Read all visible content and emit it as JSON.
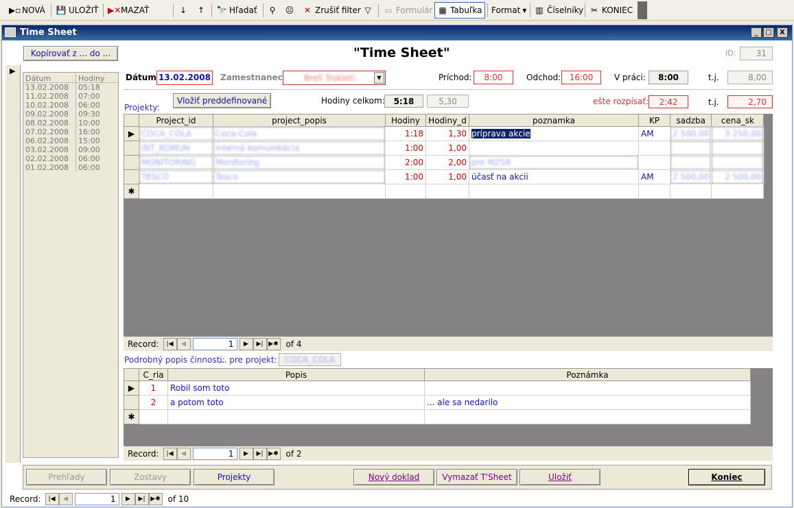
{
  "toolbar": {
    "nova": "NOVÁ",
    "ulozit": "ULOŽIŤ",
    "mazat": "MAZAŤ",
    "hladat": "Hľadať",
    "zrusit_filter": "Zrušiť filter",
    "formular": "Formulár",
    "tabulka": "Tabuľka",
    "format": "Format",
    "ciselniky": "Číselníky",
    "koniec": "KONIEC"
  },
  "window": {
    "title": "Time Sheet",
    "min": "_",
    "max": "□",
    "close": "X"
  },
  "header": {
    "kopirovat": "Kopírovať z ... do ...",
    "title": "\"Time Sheet\"",
    "id_label": "ID:",
    "id_value": "31"
  },
  "datelist": {
    "col_datum": "Dátum",
    "col_hodiny": "Hodiny",
    "rows": [
      [
        "13.02.2008",
        "05:18"
      ],
      [
        "11.02.2008",
        "07:00"
      ],
      [
        "10.02.2008",
        "06:00"
      ],
      [
        "09.02.2008",
        "09:30"
      ],
      [
        "08.02.2008",
        "10:00"
      ],
      [
        "07.02.2008",
        "16:00"
      ],
      [
        "06.02.2008",
        "15:00"
      ],
      [
        "03.02.2008",
        "09:00"
      ],
      [
        "02.02.2008",
        "06:00"
      ],
      [
        "01.02.2008",
        "06:00"
      ]
    ]
  },
  "form": {
    "datum_label": "Dátum",
    "datum_value": "13.02.2008",
    "zamestnanec_label": "Zamestnanec",
    "zamestnanec_value": "Brell Trokleti",
    "prichod_label": "Príchod:",
    "prichod_value": "8:00",
    "odchod_label": "Odchod:",
    "odchod_value": "16:00",
    "vpraci_label": "V práci:",
    "vpraci_value": "8:00",
    "tj_label": "t.j.",
    "tj_value": "8,00",
    "projekty_label": "Projekty:",
    "vlozit_btn": "Vložiť preddefinované",
    "hodiny_celkom_label": "Hodiny celkom:",
    "hodiny_celkom_value": "5:18",
    "hodiny_celkom_d": "5,30",
    "este_label": "ešte rozpísať:",
    "este_value": "2:42",
    "tj2_label": "t.j.",
    "tj2_value": "2,70"
  },
  "projects": {
    "columns": [
      "Project_id",
      "project_popis",
      "Hodiny",
      "Hodiny_d",
      "poznamka",
      "KP",
      "sadzba",
      "cena_sk"
    ],
    "rows": [
      [
        "COCA_COLA",
        "Coca-Cola",
        "1:18",
        "1,30",
        "príprava akcie",
        "AM",
        "2 500,00",
        "3 250,00"
      ],
      [
        "INT_KOMUN",
        "Interná komunikácia",
        "1:00",
        "1,00",
        "",
        "",
        "",
        ""
      ],
      [
        "MONITORING",
        "Monitoring",
        "2:00",
        "2,00",
        "pre MZSR",
        "",
        "",
        ""
      ],
      [
        "TESCO",
        "Tesco",
        "1:00",
        "1,00",
        "účasť na akcii",
        "AM",
        "2 500,00",
        "2 500,00"
      ]
    ],
    "nav": {
      "label": "Record:",
      "current": "1",
      "of": "of 4"
    }
  },
  "detail": {
    "label": "Podrobný popis činnosti:",
    "pre_projekt_label": "... pre projekt:",
    "pre_projekt_value": "COCA_COLA",
    "columns": [
      "C_ria",
      "Popis",
      "Poznámka"
    ],
    "rows": [
      [
        "1",
        "Robil som toto",
        ""
      ],
      [
        "2",
        "a potom toto",
        "... ale sa nedarilo"
      ]
    ],
    "nav": {
      "label": "Record:",
      "current": "1",
      "of": "of 2"
    }
  },
  "bottom": {
    "prehlady": "Prehľady",
    "zostavy": "Zostavy",
    "projekty": "Projekty",
    "novy_doklad": "Nový doklad",
    "vymazat": "Vymazať T'Sheet",
    "ulozit": "Uložiť",
    "koniec": "Koniec"
  },
  "mainnav": {
    "label": "Record:",
    "current": "1",
    "of": "of 10"
  }
}
